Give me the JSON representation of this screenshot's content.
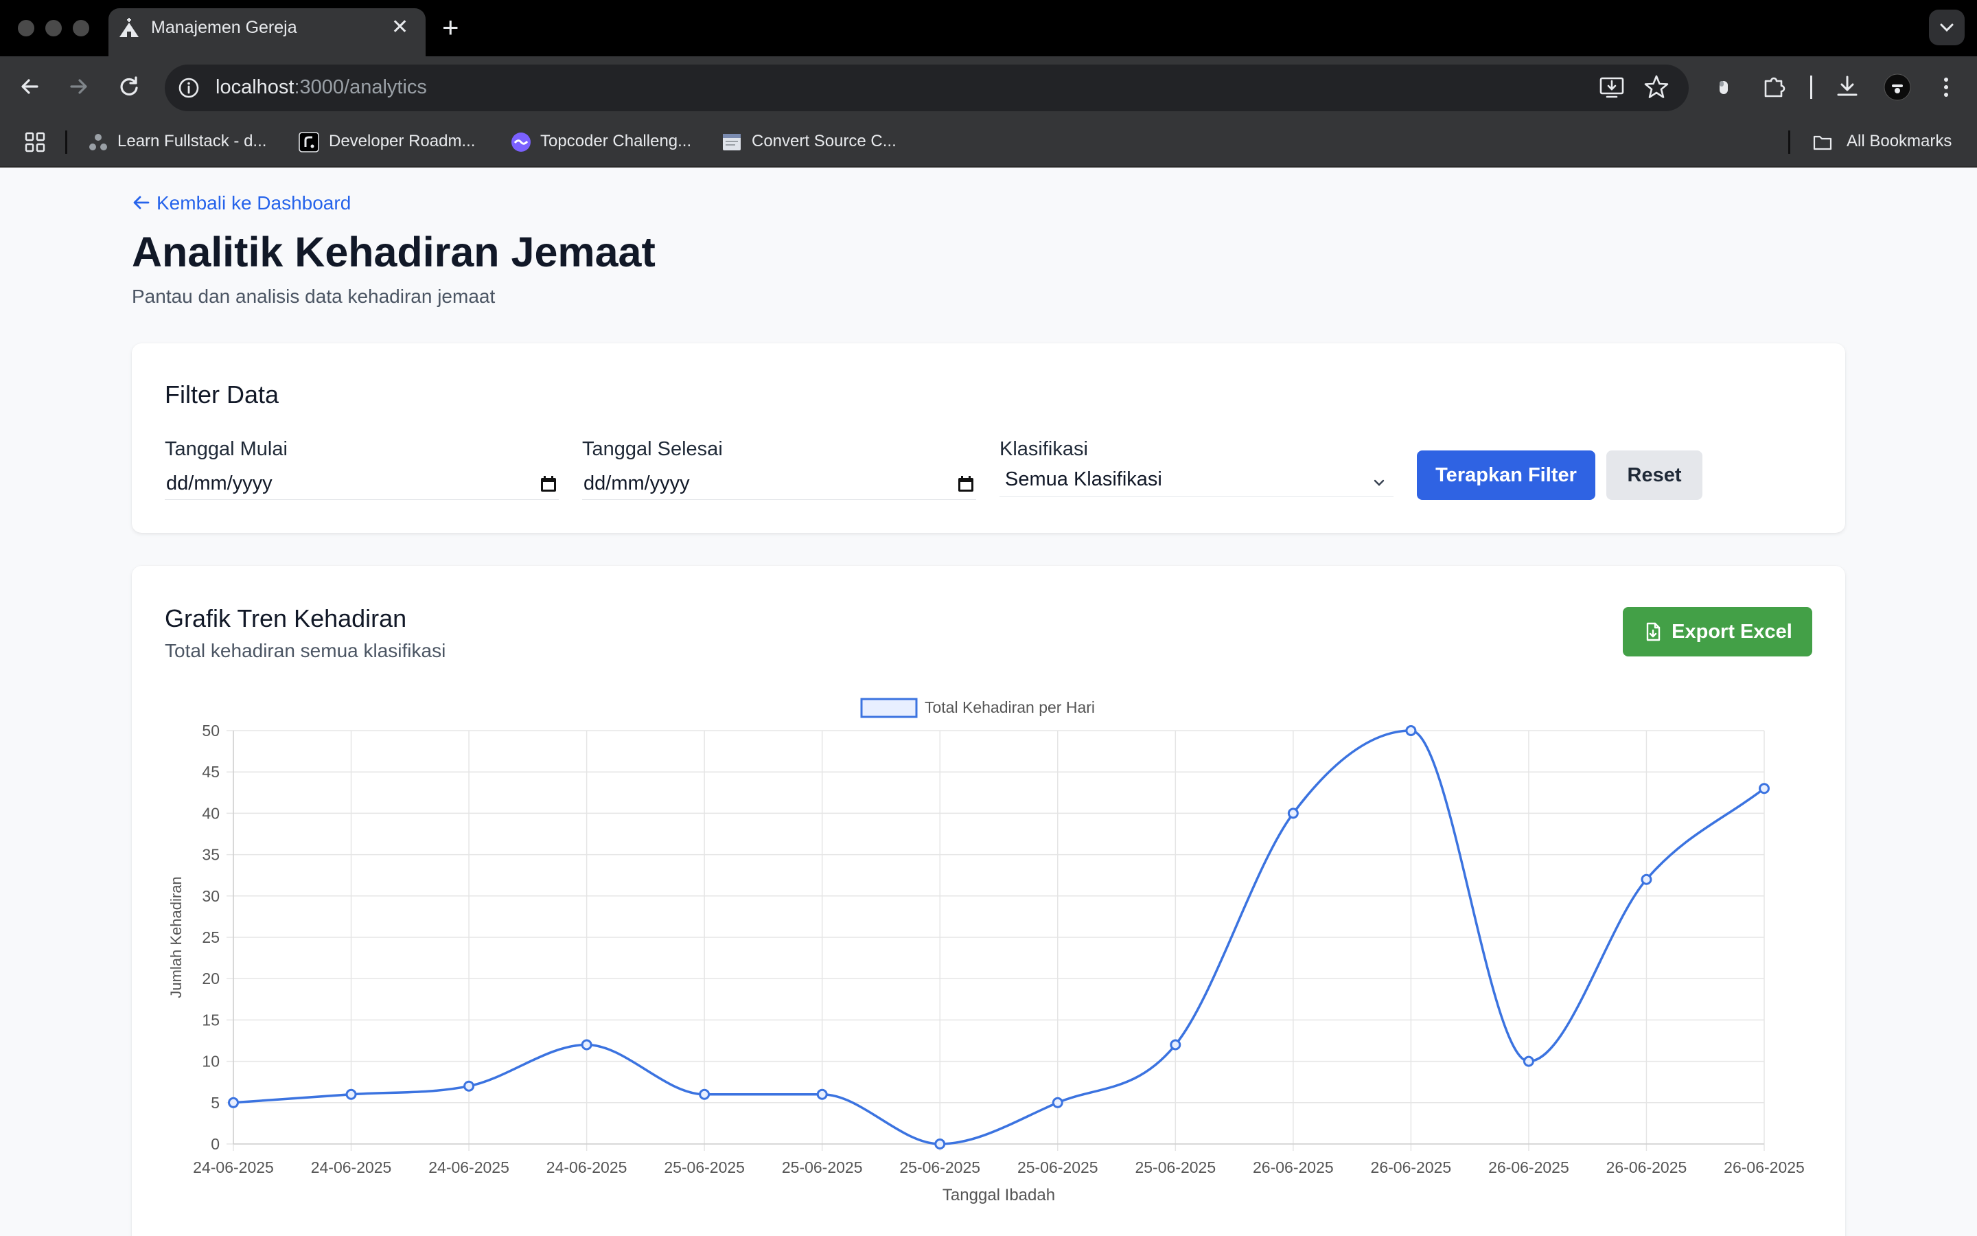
{
  "browser": {
    "tab_title": "Manajemen Gereja",
    "url_host": "localhost",
    "url_path": ":3000/analytics",
    "bookmarks": [
      "Learn Fullstack - d...",
      "Developer Roadm...",
      "Topcoder Challeng...",
      "Convert Source C..."
    ],
    "all_bookmarks": "All Bookmarks"
  },
  "page": {
    "back_link": "Kembali ke Dashboard",
    "title": "Analitik Kehadiran Jemaat",
    "subtitle": "Pantau dan analisis data kehadiran jemaat"
  },
  "filter": {
    "title": "Filter Data",
    "start_label": "Tanggal Mulai",
    "start_value": "dd/mm/yyyy",
    "end_label": "Tanggal Selesai",
    "end_value": "dd/mm/yyyy",
    "class_label": "Klasifikasi",
    "class_value": "Semua Klasifikasi",
    "apply_label": "Terapkan Filter",
    "reset_label": "Reset"
  },
  "chart_card": {
    "title": "Grafik Tren Kehadiran",
    "subtitle": "Total kehadiran semua klasifikasi",
    "export_label": "Export Excel"
  },
  "colors": {
    "accent_blue": "#2f63e3",
    "line_blue": "#3b73e0",
    "export_green": "#43a047"
  },
  "chart_data": {
    "type": "line",
    "title": "",
    "xlabel": "Tanggal Ibadah",
    "ylabel": "Jumlah Kehadiran",
    "ylim": [
      0,
      50
    ],
    "yticks": [
      0,
      5,
      10,
      15,
      20,
      25,
      30,
      35,
      40,
      45,
      50
    ],
    "grid": true,
    "legend_position": "top-center",
    "x": [
      "24-06-2025",
      "24-06-2025",
      "24-06-2025",
      "24-06-2025",
      "25-06-2025",
      "25-06-2025",
      "25-06-2025",
      "25-06-2025",
      "25-06-2025",
      "26-06-2025",
      "26-06-2025",
      "26-06-2025",
      "26-06-2025",
      "26-06-2025"
    ],
    "series": [
      {
        "name": "Total Kehadiran per Hari",
        "values": [
          5,
          6,
          7,
          12,
          6,
          6,
          0,
          5,
          12,
          40,
          50,
          10,
          32,
          43
        ]
      }
    ]
  }
}
